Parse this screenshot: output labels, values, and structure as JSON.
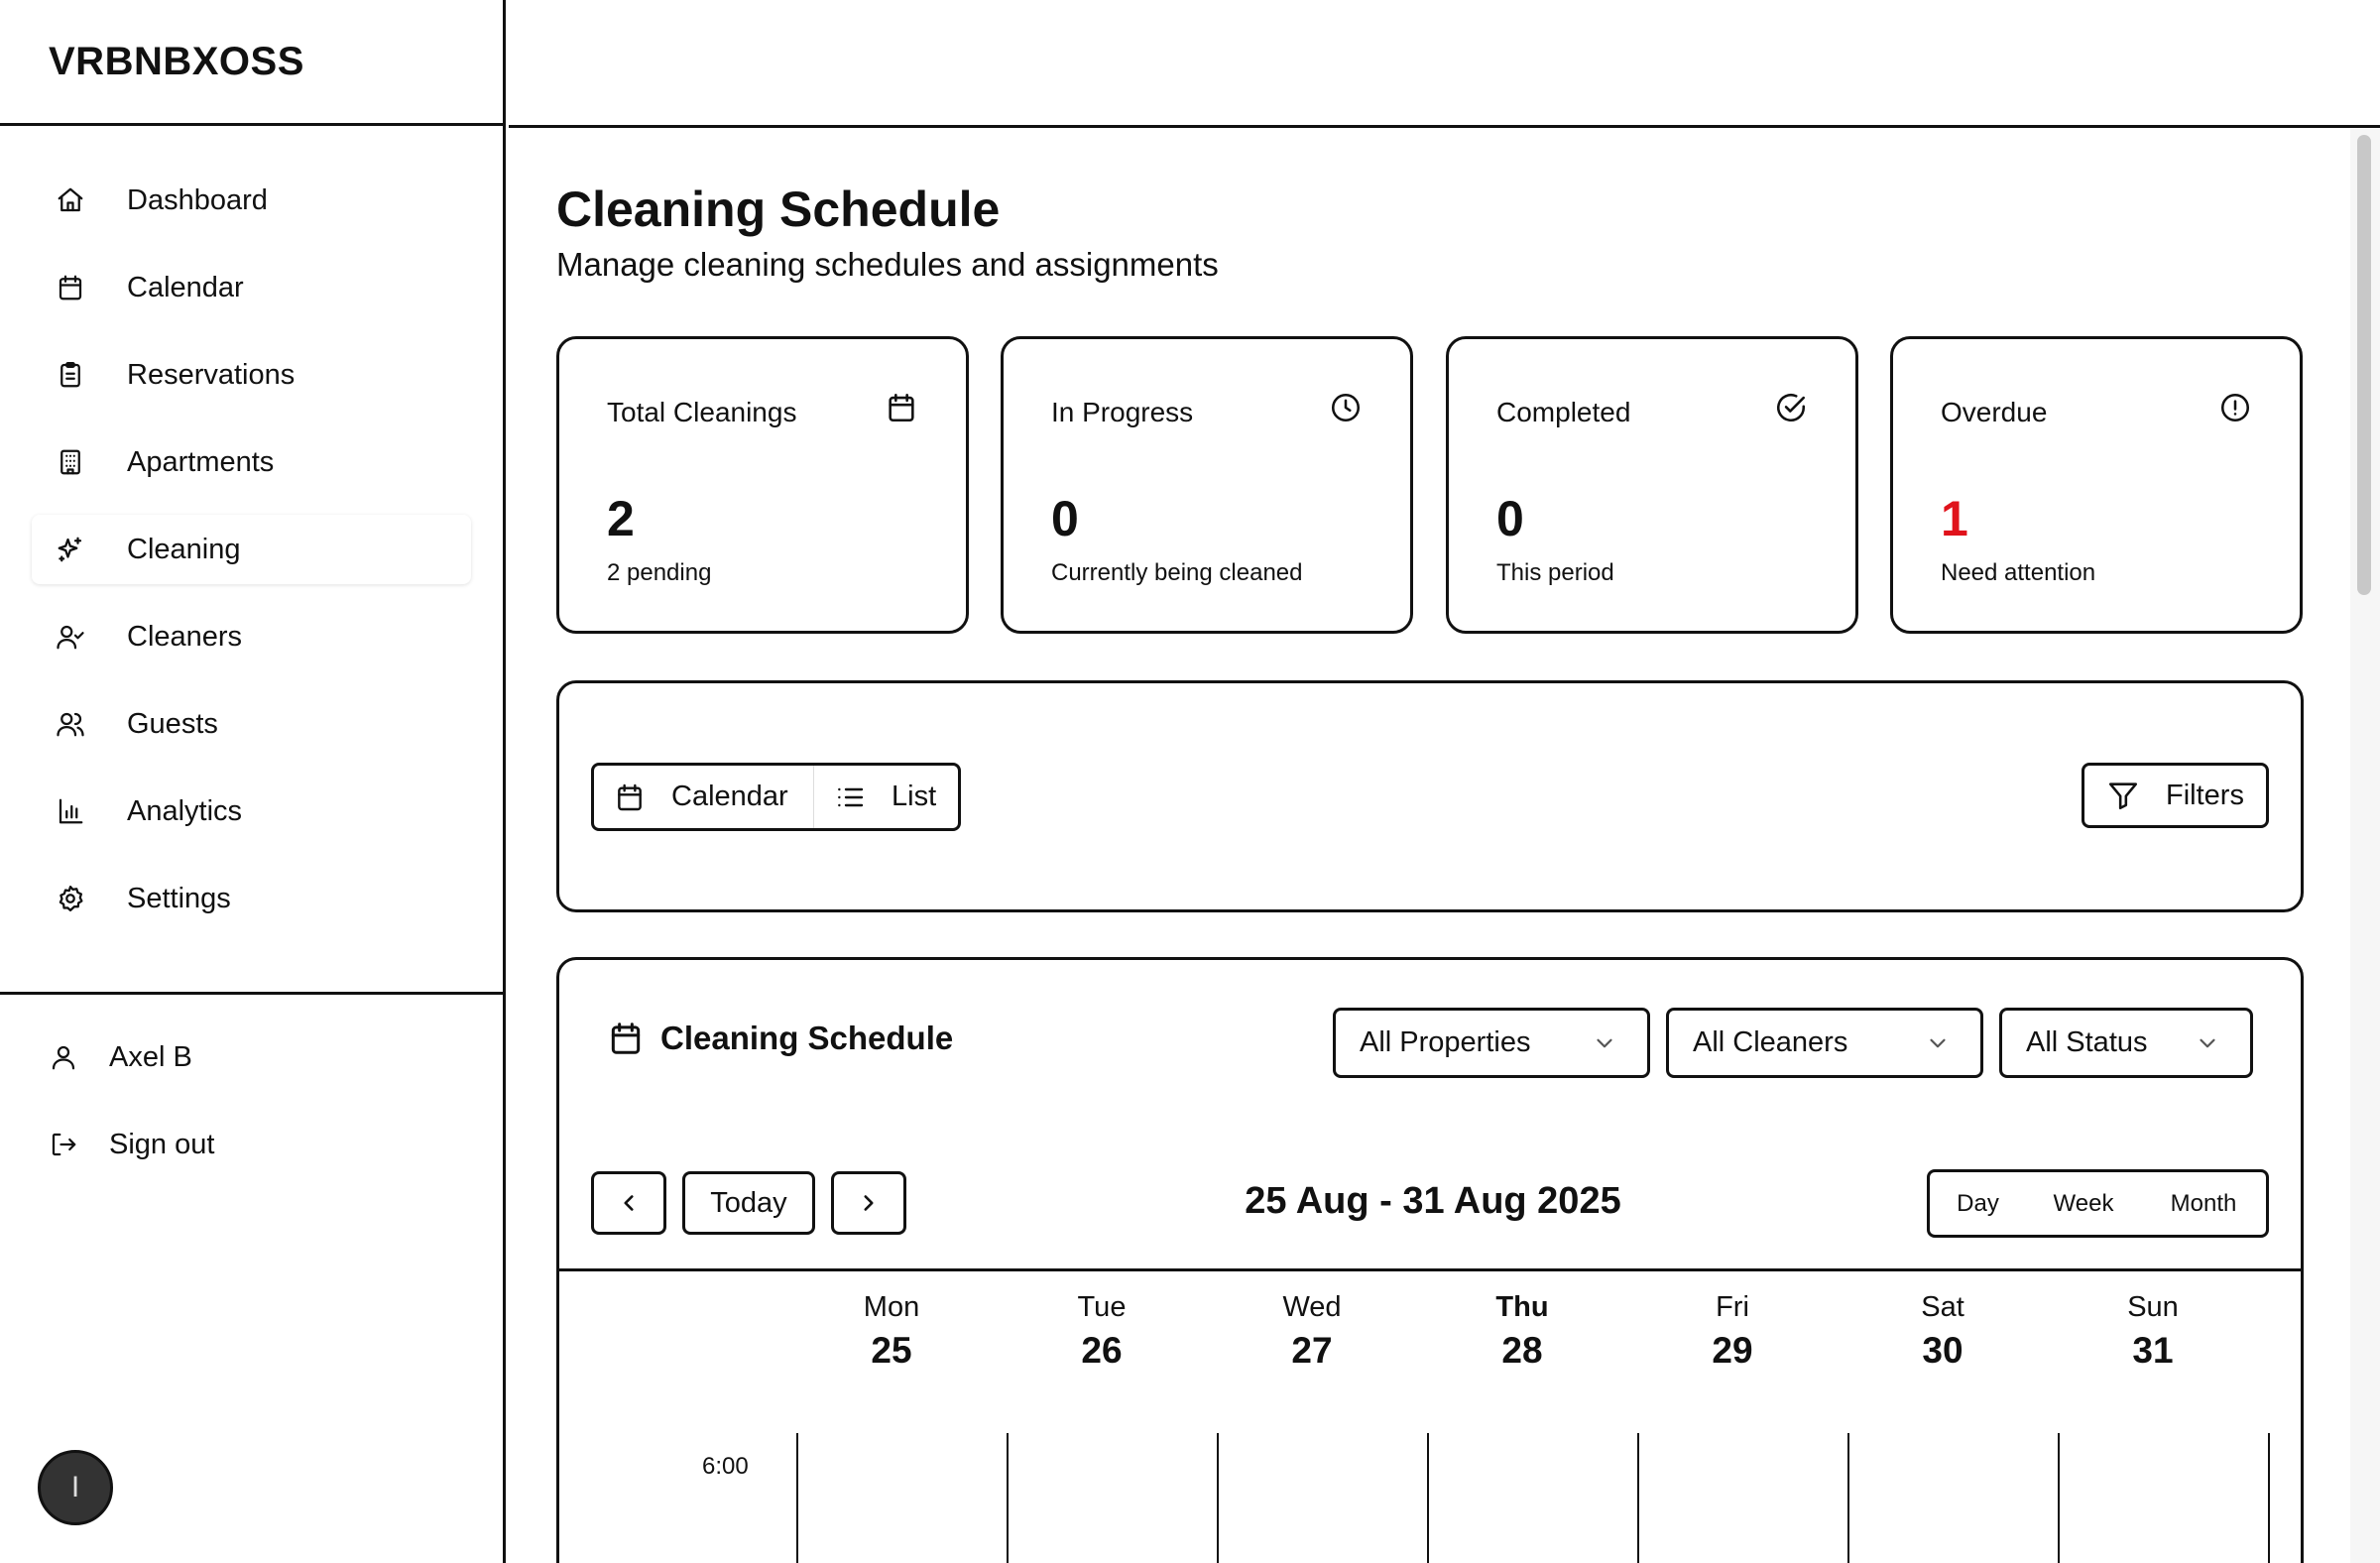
{
  "app": {
    "brand": "VRBNBXOSS"
  },
  "sidebar": {
    "items": [
      {
        "label": "Dashboard",
        "icon": "home-icon"
      },
      {
        "label": "Calendar",
        "icon": "calendar-icon"
      },
      {
        "label": "Reservations",
        "icon": "clipboard-icon"
      },
      {
        "label": "Apartments",
        "icon": "building-icon"
      },
      {
        "label": "Cleaning",
        "icon": "sparkles-icon",
        "active": true
      },
      {
        "label": "Cleaners",
        "icon": "user-check-icon"
      },
      {
        "label": "Guests",
        "icon": "users-icon"
      },
      {
        "label": "Analytics",
        "icon": "bar-chart-icon"
      },
      {
        "label": "Settings",
        "icon": "gear-icon"
      }
    ],
    "user": {
      "name": "Axel B",
      "icon": "user-icon"
    },
    "sign_out": {
      "label": "Sign out",
      "icon": "sign-out-icon"
    },
    "fab": {
      "label": "I"
    }
  },
  "page": {
    "title": "Cleaning Schedule",
    "subtitle": "Manage cleaning schedules and assignments"
  },
  "stats": [
    {
      "label": "Total Cleanings",
      "value": "2",
      "note": "2 pending",
      "icon": "calendar-icon"
    },
    {
      "label": "In Progress",
      "value": "0",
      "note": "Currently being cleaned",
      "icon": "clock-icon"
    },
    {
      "label": "Completed",
      "value": "0",
      "note": "This period",
      "icon": "check-circle-icon"
    },
    {
      "label": "Overdue",
      "value": "1",
      "note": "Need attention",
      "icon": "alert-circle-icon",
      "accent": "#e0121b"
    }
  ],
  "toolbar": {
    "calendar_label": "Calendar",
    "list_label": "List",
    "filters_label": "Filters"
  },
  "schedule": {
    "title": "Cleaning Schedule",
    "filters": {
      "property": "All Properties",
      "cleaner": "All Cleaners",
      "status": "All Status"
    },
    "today_label": "Today",
    "range": "25 Aug - 31 Aug 2025",
    "views": [
      "Day",
      "Week",
      "Month"
    ],
    "days": [
      {
        "name": "Mon",
        "date": "25"
      },
      {
        "name": "Tue",
        "date": "26"
      },
      {
        "name": "Wed",
        "date": "27"
      },
      {
        "name": "Thu",
        "date": "28",
        "today": true
      },
      {
        "name": "Fri",
        "date": "29"
      },
      {
        "name": "Sat",
        "date": "30"
      },
      {
        "name": "Sun",
        "date": "31"
      }
    ],
    "first_hour": "6:00"
  }
}
